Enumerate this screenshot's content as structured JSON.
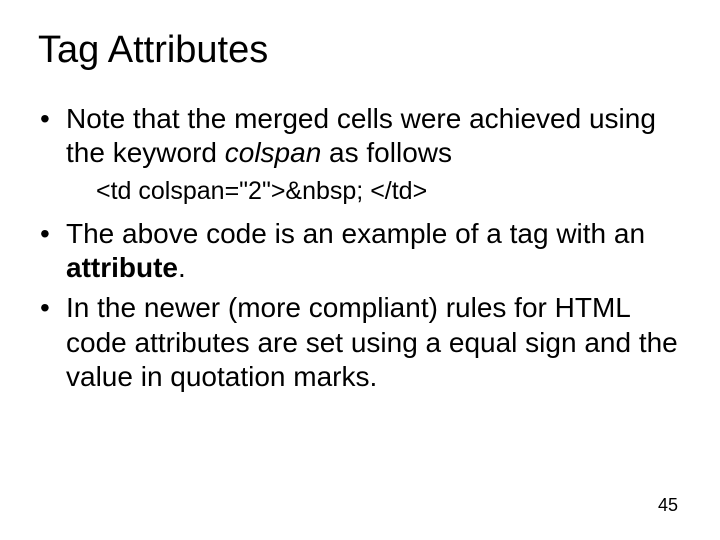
{
  "title": "Tag Attributes",
  "bullet1_a": "Note that the merged cells were achieved using the keyword ",
  "bullet1_italic": "colspan",
  "bullet1_b": " as follows",
  "code_line": "<td colspan=\"2\">&nbsp; </td>",
  "bullet2_a": "The above code is an example of a tag with an ",
  "bullet2_bold": "attribute",
  "bullet2_b": ".",
  "bullet3": "In the newer (more compliant) rules for HTML code attributes are set using a equal sign and the value in quotation marks.",
  "page_number": "45"
}
